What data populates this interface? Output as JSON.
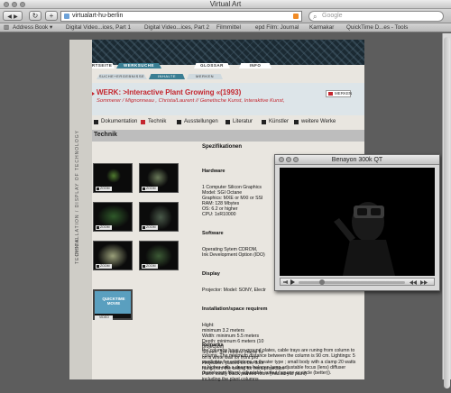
{
  "window": {
    "title": "Virtual Art"
  },
  "toolbar": {
    "back": "◀",
    "forward": "▶",
    "reload": "↻",
    "add": "+",
    "url": "virtualart-hu-berlin",
    "search_placeholder": "Google"
  },
  "bookmarks": [
    "Address Book ▾",
    "Digital Video...ices, Part 1",
    "Digital Video...ices, Part 2",
    "Filmmittel",
    "epd Film: Journal",
    "Karmakar",
    "QuickTime D...es - Tools"
  ],
  "nav": {
    "tabs": [
      "STARTSEITE",
      "WERKSUCHE",
      "GLOSSAR",
      "INFO"
    ],
    "subtabs": [
      "SUCHE+ERGEBNISSE",
      "INHALTE",
      "MERKEN"
    ]
  },
  "side": {
    "vtext1": "INSTALLATION / DISPLAY OF TECHNOLOGY",
    "vtext2": "TECHNIK"
  },
  "work": {
    "title": "WERK: >Interactive Plant Growing «(1993)",
    "subtitle": "Sommerer / Mignonneau , Christa/Laurent // Genetische Kunst, Interaktive Kunst,",
    "merken": "MERKEN"
  },
  "tabs": [
    "Dokumentation",
    "Technik",
    "Ausstellungen",
    "Literatur",
    "Künstler",
    "weitere Werke"
  ],
  "section": {
    "title": "Technik",
    "spec_header": "Spezifikationen"
  },
  "thumb_label": "ZOOM",
  "video": {
    "label": "QUICKTIME MOVIE",
    "sublabel": "VIDEO"
  },
  "specs": {
    "hardware_h": "Hardware",
    "hardware": "1 Computer Silicon Graphics\nModel: SGI Octane\nGraphics: MXE or MXI or SSI\nRAM: 128 Mbytes\nOS: 6.2 or higher\nCPU: 1xR10000",
    "software_h": "Software",
    "software": "Operating Sytem CDROM,\nInk Development Option (IDO)",
    "display_h": "Display",
    "display": "Projector: Model: SONY, Electr",
    "install_h": "Installation/space requirem",
    "install": "Hight:\nminimum 3.2 meters\nWidth: minimum 5.5 meters\nDepth: minimum 6 meters (10\nprojection)\nScreen: 3x4 meters (frame fu\non a white wall for front pro\nProjection: placed on the floor\nhang from the ceiling for front projection\nPaint: totally black painted room (mat acrylic paint)\nincluding the plant columns"
  },
  "remarks": {
    "h": "Remarks",
    "text": "the columns have no ground plates, cable trays are runing from column to column. The minimum distance between the column is 90 cm. Lightings: 5 spotlights for exhibitions or theater type ; small body with a clamp 20 watts or higher with a dearner halogen lamp adjustable focus (lens) diffuser (translucent filters) adjustable cutout (square or circle (better))."
  },
  "qt_player": {
    "title": "Benayon 300k QT",
    "position": 0.22
  }
}
